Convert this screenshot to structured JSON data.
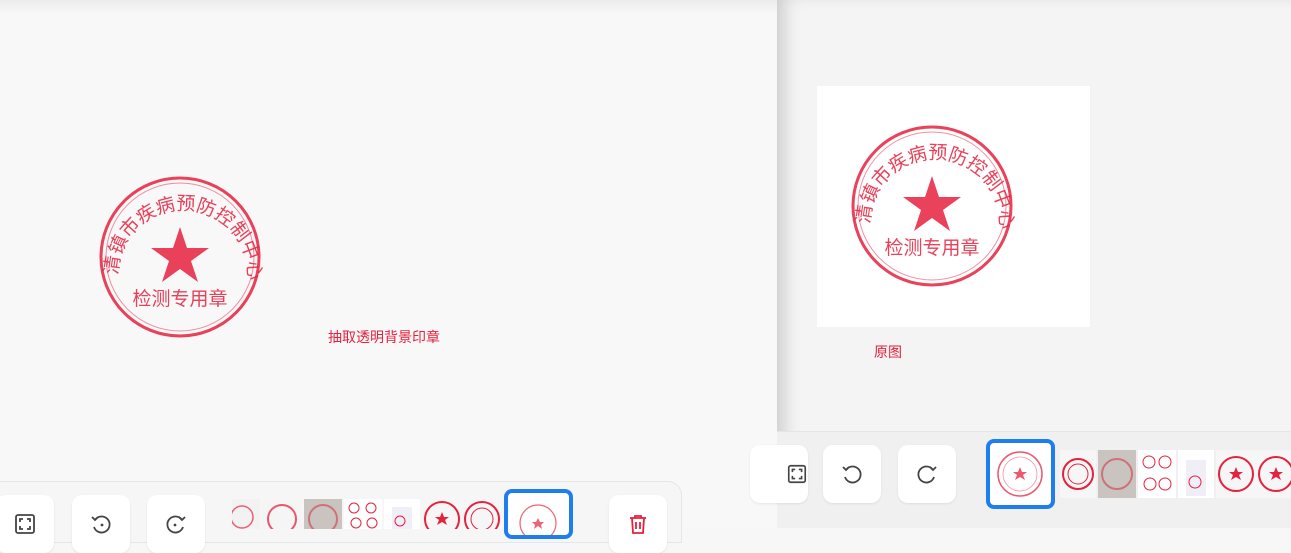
{
  "app": {
    "accent_color": "#1e7ef0",
    "stamp_color": "#e5213d"
  },
  "left_panel": {
    "caption": "抽取透明背景印章",
    "stamp": {
      "top_text": "清镇市疾病预防控制中心",
      "bottom_text": "检测专用章",
      "icon": "star-icon"
    }
  },
  "right_panel": {
    "caption": "原图",
    "stamp": {
      "top_text": "清镇市疾病预防控制中心",
      "bottom_text": "检测专用章",
      "icon": "star-icon"
    }
  },
  "toolbar": {
    "buttons": [
      {
        "name": "fullscreen-button",
        "icon": "fullscreen-icon"
      },
      {
        "name": "rotate-left-button",
        "icon": "rotate-left-icon"
      },
      {
        "name": "rotate-right-button",
        "icon": "rotate-right-icon"
      },
      {
        "name": "delete-button",
        "icon": "trash-icon"
      }
    ],
    "thumbnail_count": 8,
    "selected_thumbnail": 8
  }
}
